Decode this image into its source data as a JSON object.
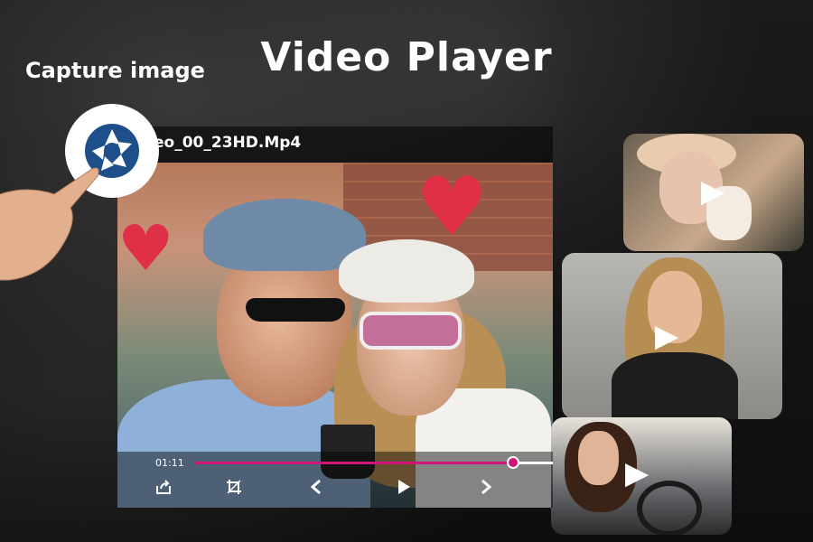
{
  "header": {
    "title": "Video Player",
    "capture_label": "Capture image"
  },
  "player": {
    "file_name": "eo_00_23HD.Mp4",
    "current_time": "01:11",
    "progress_fraction": 0.89,
    "accent_color": "#d0157a"
  },
  "controls": {
    "share_icon": "share-icon",
    "crop_icon": "crop-icon",
    "prev_icon": "chevron-left-icon",
    "play_icon": "play-icon",
    "next_icon": "chevron-right-icon"
  },
  "thumbnails": [
    {
      "name": "thumbnail-woman-with-dog",
      "icon": "play-icon"
    },
    {
      "name": "thumbnail-woman-portrait",
      "icon": "play-icon"
    },
    {
      "name": "thumbnail-woman-driving",
      "icon": "play-icon"
    }
  ]
}
